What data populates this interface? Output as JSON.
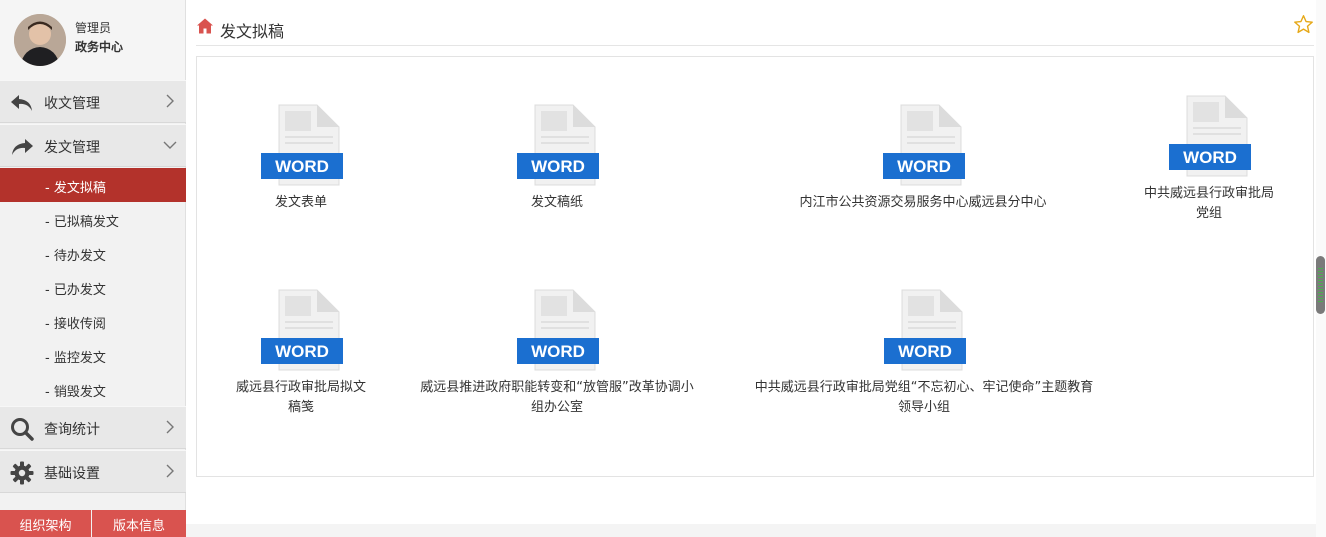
{
  "user": {
    "role": "管理员",
    "department": "政务中心"
  },
  "sidebar": {
    "menus": [
      {
        "label": "收文管理",
        "icon": "reply-arrow-icon",
        "expanded": false
      },
      {
        "label": "发文管理",
        "icon": "forward-arrow-icon",
        "expanded": true
      },
      {
        "label": "查询统计",
        "icon": "search-icon",
        "expanded": false
      },
      {
        "label": "基础设置",
        "icon": "gear-icon",
        "expanded": false
      }
    ],
    "submenu": [
      {
        "label": "- 发文拟稿",
        "active": true
      },
      {
        "label": "- 已拟稿发文",
        "active": false
      },
      {
        "label": "- 待办发文",
        "active": false
      },
      {
        "label": "- 已办发文",
        "active": false
      },
      {
        "label": "- 接收传阅",
        "active": false
      },
      {
        "label": "- 监控发文",
        "active": false
      },
      {
        "label": "- 销毁发文",
        "active": false
      }
    ],
    "bottom_buttons": [
      "组织架构",
      "版本信息"
    ]
  },
  "breadcrumb": {
    "title": "发文拟稿"
  },
  "doc_badge": "WORD",
  "documents": [
    {
      "label": "发文表单"
    },
    {
      "label": "发文稿纸"
    },
    {
      "label": "内江市公共资源交易服务中心威远县分中心"
    },
    {
      "label": "中共威远县行政审批局党组"
    },
    {
      "label": "威远县行政审批局拟文稿笺"
    },
    {
      "label": "威远县推进政府职能转变和“放管服”改革协调小组办公室"
    },
    {
      "label": "中共威远县行政审批局党组“不忘初心、牢记使命”主题教育领导小组"
    }
  ],
  "colors": {
    "accent": "#b3322b",
    "bottom_button": "#d9534f",
    "word_blue": "#1b6fd0",
    "star": "#e6a817"
  }
}
